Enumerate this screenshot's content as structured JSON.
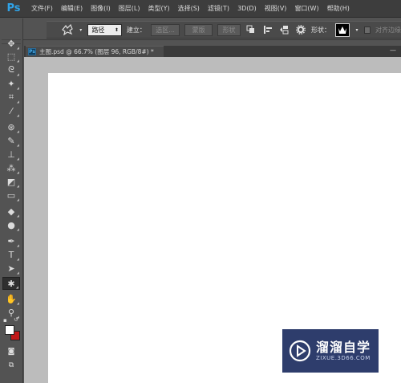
{
  "menubar": {
    "logo": "Ps",
    "items": [
      "文件(F)",
      "编辑(E)",
      "图像(I)",
      "图层(L)",
      "类型(Y)",
      "选择(S)",
      "滤镜(T)",
      "3D(D)",
      "视图(V)",
      "窗口(W)",
      "帮助(H)"
    ]
  },
  "optionsbar": {
    "collapse_glyph": "»",
    "mode_value": "路径",
    "create_label": "建立：",
    "selection_button": "选区...",
    "mask_button": "蒙版",
    "shape_button": "形状",
    "shape_label": "形状：",
    "align_edges_label": "对齐边缘"
  },
  "toolbar": {
    "tools": [
      {
        "name": "move-tool-icon",
        "glyph": "✥"
      },
      {
        "name": "marquee-tool-icon",
        "glyph": "⬚"
      },
      {
        "name": "lasso-tool-icon",
        "glyph": "ᘓ"
      },
      {
        "name": "magic-wand-tool-icon",
        "glyph": "✦"
      },
      {
        "name": "crop-tool-icon",
        "glyph": "⌗"
      },
      {
        "name": "eyedropper-tool-icon",
        "glyph": "⁄"
      },
      {
        "name": "healing-brush-tool-icon",
        "glyph": "⊛"
      },
      {
        "name": "brush-tool-icon",
        "glyph": "✎"
      },
      {
        "name": "clone-stamp-tool-icon",
        "glyph": "⊥"
      },
      {
        "name": "history-brush-tool-icon",
        "glyph": "⁂"
      },
      {
        "name": "eraser-tool-icon",
        "glyph": "◩"
      },
      {
        "name": "gradient-tool-icon",
        "glyph": "▭"
      },
      {
        "name": "blur-tool-icon",
        "glyph": "◆"
      },
      {
        "name": "dodge-tool-icon",
        "glyph": "●"
      },
      {
        "name": "pen-tool-icon",
        "glyph": "✒"
      },
      {
        "name": "type-tool-icon",
        "glyph": "T"
      },
      {
        "name": "path-selection-tool-icon",
        "glyph": "➤"
      },
      {
        "name": "custom-shape-tool-icon",
        "glyph": "✱"
      },
      {
        "name": "hand-tool-icon",
        "glyph": "✋"
      },
      {
        "name": "zoom-tool-icon",
        "glyph": "⚲"
      }
    ],
    "active_tool": "custom-shape-tool-icon",
    "foreground_color": "#ffffff",
    "background_color": "#c01818"
  },
  "document": {
    "title": "主图.psd @ 66.7% (图层 96, RGB/8#) *",
    "tab_icon": "Ps",
    "minimize_glyph": "—"
  },
  "watermark": {
    "title": "溜溜自学",
    "url": "ZIXUE.3D66.COM"
  }
}
